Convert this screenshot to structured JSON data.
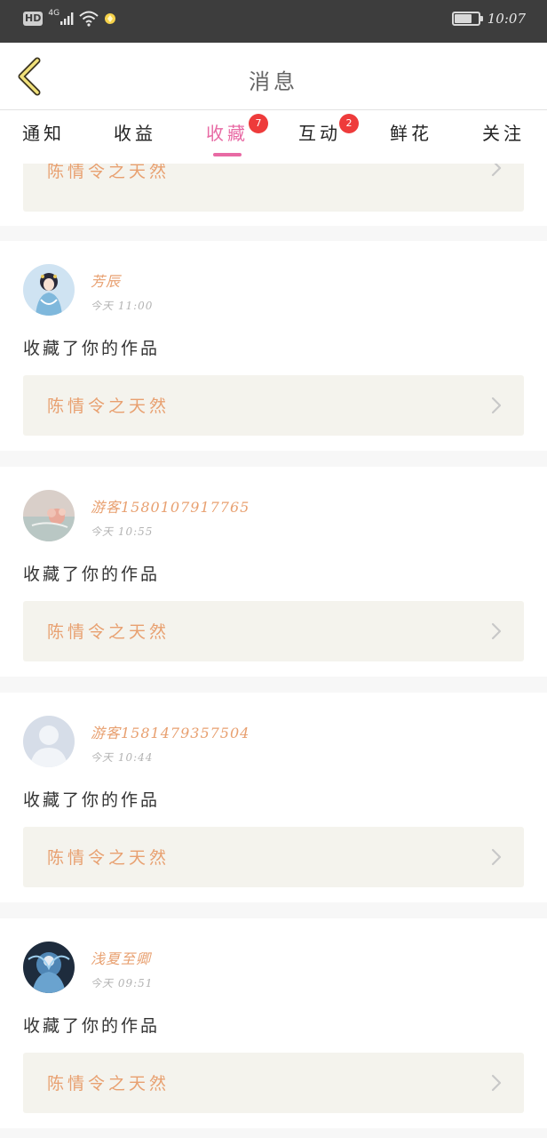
{
  "status_bar": {
    "hd": "HD",
    "network": "4G",
    "time": "10:07",
    "battery_level": 0.75
  },
  "header": {
    "title": "消息",
    "back_icon": "chevron-left-icon"
  },
  "tabs": [
    {
      "label": "通知",
      "badge": ""
    },
    {
      "label": "收益",
      "badge": ""
    },
    {
      "label": "收藏",
      "badge": "7",
      "active": true
    },
    {
      "label": "互动",
      "badge": "2"
    },
    {
      "label": "鲜花",
      "badge": ""
    },
    {
      "label": "关注",
      "badge": ""
    }
  ],
  "partial_top": {
    "work_title": "陈情令之天然"
  },
  "notifications": [
    {
      "username": "芳辰",
      "time": "今天 11:00",
      "action": "收藏了你的作品",
      "work_title": "陈情令之天然",
      "avatar": "illustrated-girl"
    },
    {
      "username": "游客1580107917765",
      "time": "今天 10:55",
      "action": "收藏了你的作品",
      "work_title": "陈情令之天然",
      "avatar": "pink-flowers"
    },
    {
      "username": "游客1581479357504",
      "time": "今天 10:44",
      "action": "收藏了你的作品",
      "work_title": "陈情令之天然",
      "avatar": "default-user"
    },
    {
      "username": "浅夏至卿",
      "time": "今天 09:51",
      "action": "收藏了你的作品",
      "work_title": "陈情令之天然",
      "avatar": "blue-fantasy"
    }
  ],
  "colors": {
    "accent_pink": "#e86aa4",
    "badge_red": "#ee3b3b",
    "username_orange": "#e8a070",
    "work_box_bg": "#f4f3ed",
    "statusbar_bg": "#3d3d3d"
  }
}
